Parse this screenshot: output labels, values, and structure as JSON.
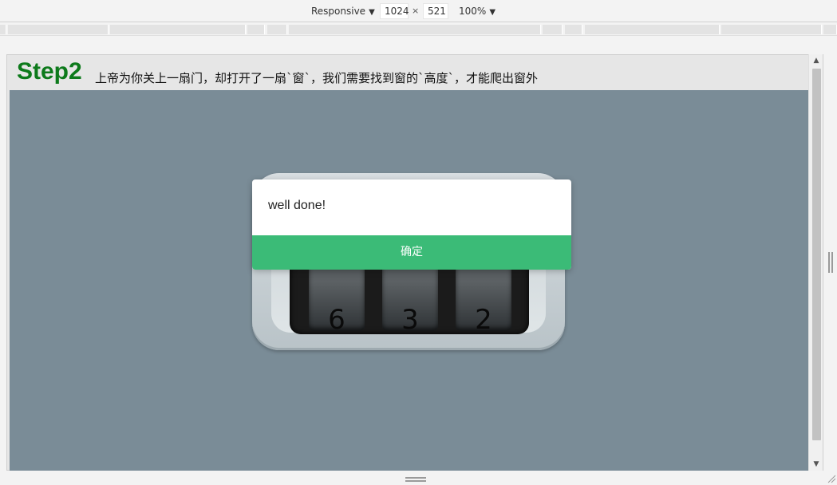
{
  "toolbar": {
    "device": "Responsive",
    "width": "1024",
    "times": "×",
    "height": "521",
    "zoom": "100%",
    "dropdown_glyph": "▼"
  },
  "page": {
    "step_title": "Step2",
    "description": "上帝为你关上一扇门，却打开了一扇`窗`，我们需要找到窗的`高度`，才能爬出窗外"
  },
  "lock": {
    "dials": [
      "6",
      "3",
      "2"
    ]
  },
  "modal": {
    "message": "well done!",
    "confirm_label": "确定",
    "button_color": "#3bbb77"
  },
  "scrollbar": {
    "up_glyph": "▲",
    "down_glyph": "▼"
  },
  "colors": {
    "step_title": "#0d7a1b",
    "stage_background": "#7a8c97"
  }
}
